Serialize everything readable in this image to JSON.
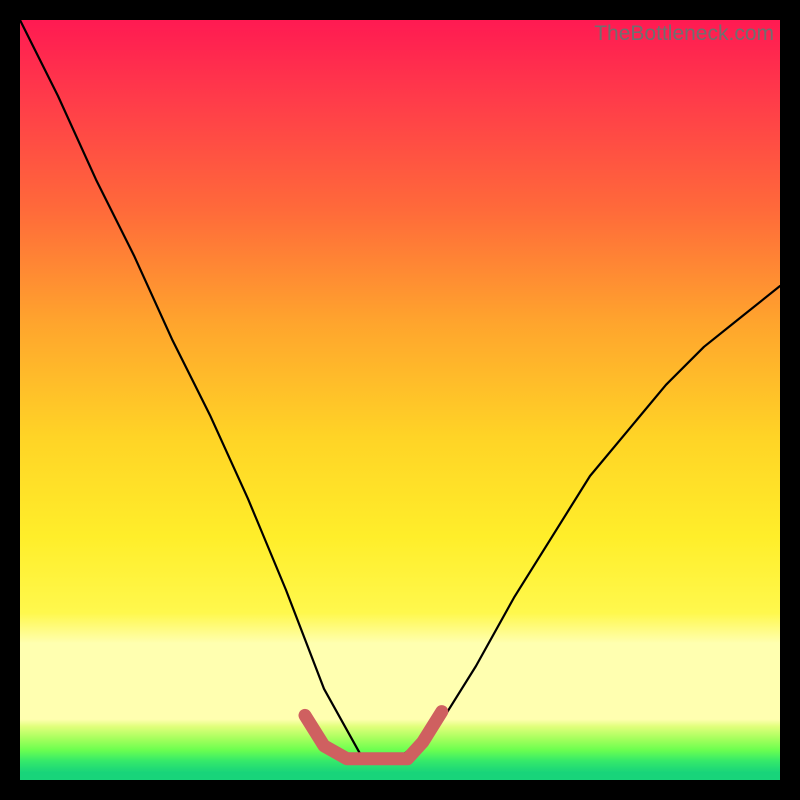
{
  "watermark": {
    "text": "TheBottleneck.com"
  },
  "chart_data": {
    "type": "line",
    "title": "",
    "xlabel": "",
    "ylabel": "",
    "xlim": [
      0,
      1
    ],
    "ylim": [
      0,
      1
    ],
    "series": [
      {
        "name": "black-curve",
        "color": "#000000",
        "x": [
          0.0,
          0.05,
          0.1,
          0.15,
          0.2,
          0.25,
          0.3,
          0.35,
          0.4,
          0.45,
          0.5,
          0.55,
          0.6,
          0.65,
          0.7,
          0.75,
          0.8,
          0.85,
          0.9,
          0.95,
          1.0
        ],
        "values": [
          1.0,
          0.9,
          0.79,
          0.69,
          0.58,
          0.48,
          0.37,
          0.25,
          0.12,
          0.03,
          0.03,
          0.07,
          0.15,
          0.24,
          0.32,
          0.4,
          0.46,
          0.52,
          0.57,
          0.61,
          0.65
        ]
      },
      {
        "name": "red-curve",
        "color": "#cf6060",
        "x": [
          0.375,
          0.4,
          0.43,
          0.47,
          0.51,
          0.53,
          0.555
        ],
        "values": [
          0.085,
          0.045,
          0.028,
          0.028,
          0.028,
          0.05,
          0.09
        ]
      }
    ],
    "annotations": []
  }
}
